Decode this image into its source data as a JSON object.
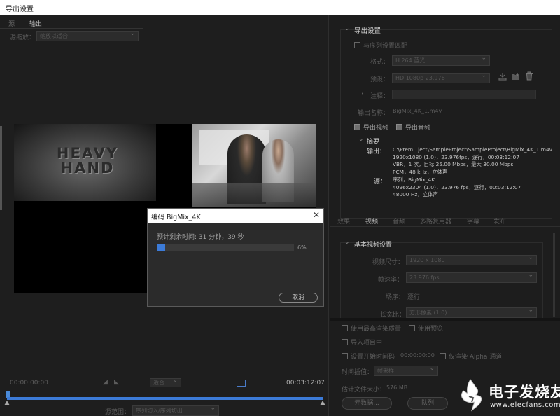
{
  "window": {
    "title": "导出设置"
  },
  "left": {
    "tabs": {
      "source": "源",
      "output": "输出"
    },
    "source_scaling_label": "源缩放：",
    "source_scaling_value": "缩放以适合",
    "timeline": {
      "timecode_start": "00:00:00:00",
      "fit_label": "适合",
      "timecode_end": "00:03:12:07",
      "range_label": "源范围：",
      "range_value": "序列切入/序列切出"
    }
  },
  "dialog": {
    "title": "编码 BigMix_4K",
    "remaining": "预计剩余时间: 31 分钟，39 秒",
    "progress": 0.06,
    "progress_label": "6%",
    "cancel": "取消"
  },
  "export_settings": {
    "section_title": "导出设置",
    "match_sequence": "与序列设置匹配",
    "format_label": "格式：",
    "format_value": "H.264 蓝光",
    "preset_label": "预设：",
    "preset_value": "HD 1080p 23.976",
    "comments_label": "注释：",
    "output_name_label": "输出名称：",
    "output_name_value": "BigMix_4K_1.m4v",
    "export_video": "导出视频",
    "export_audio": "导出音频",
    "summary_title": "摘要",
    "output_label": "输出：",
    "output_lines": [
      "C:\\Prem...ject\\SampleProject\\SampleProject\\BigMix_4K_1.m4v",
      "1920x1080 (1.0)，23.976fps，逐行，00:03:12:07",
      "VBR，1 次，目标 25.00 Mbps，最大 30.00 Mbps",
      "PCM，48 kHz，立体声"
    ],
    "source_label": "源：",
    "source_lines": [
      "序列，BigMix_4K",
      "4096x2304 (1.0)，23.976 fps，逐行，00:03:12:07",
      "48000 Hz，立体声"
    ]
  },
  "tabs": [
    "效果",
    "视频",
    "音频",
    "多路复用器",
    "字幕",
    "发布"
  ],
  "video_settings": {
    "title": "基本视频设置",
    "frame_size_label": "视频尺寸：",
    "frame_size_value": "1920 x 1080",
    "frame_rate_label": "帧速率：",
    "frame_rate_value": "23.976 fps",
    "field_order_label": "场序：",
    "field_order_value": "逐行",
    "aspect_label": "长宽比：",
    "aspect_value": "方形像素 (1.0)"
  },
  "bottom": {
    "max_render": "使用最高渲染质量",
    "use_previews": "使用预览",
    "import_project": "导入项目中",
    "set_start_tc": "设置开始时间码",
    "start_tc_value": "00:00:00:00",
    "alpha_only": "仅渲染 Alpha 通道",
    "interp_label": "时间插值：",
    "interp_value": "帧采样",
    "filesize_label": "估计文件大小：",
    "filesize_value": "576 MB",
    "metadata_btn": "元数据...",
    "queue_btn": "队列"
  },
  "watermark": {
    "main": "电子发烧友",
    "url": "www.elecfans.com"
  },
  "preview": {
    "left_logo_text": "HEAVY HAND"
  }
}
